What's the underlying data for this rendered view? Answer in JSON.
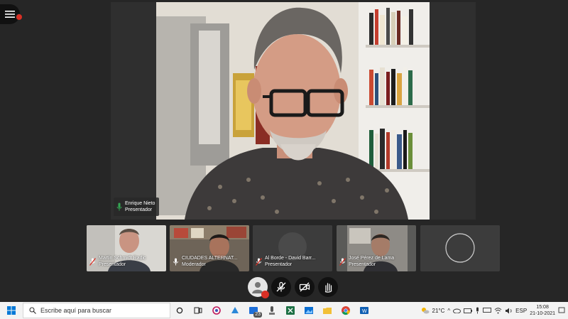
{
  "main_speaker": {
    "name": "Enrique Nieto",
    "role": "Presentador"
  },
  "participants": [
    {
      "name": "Martin Schmidt Radic",
      "role": "Presentador",
      "muted": true
    },
    {
      "name": "CIUDADES ALTERNAT...",
      "role": "Moderador",
      "muted": false
    },
    {
      "name": "Al Borde - David Barr...",
      "role": "Presentador",
      "muted": true
    },
    {
      "name": "José Pérez de Lama",
      "role": "Presentador",
      "muted": true
    }
  ],
  "controls": [
    "avatar-icon",
    "mic-off-icon",
    "camera-off-icon",
    "raise-hand-icon"
  ],
  "taskbar": {
    "search_placeholder": "Escribe aquí para buscar",
    "badge_count": "23",
    "weather": "21°C",
    "language": "ESP",
    "time": "15:08",
    "date": "21-10-2021"
  },
  "colors": {
    "accent_red": "#d93025",
    "speaking_green": "#34a853",
    "background": "#262626"
  }
}
